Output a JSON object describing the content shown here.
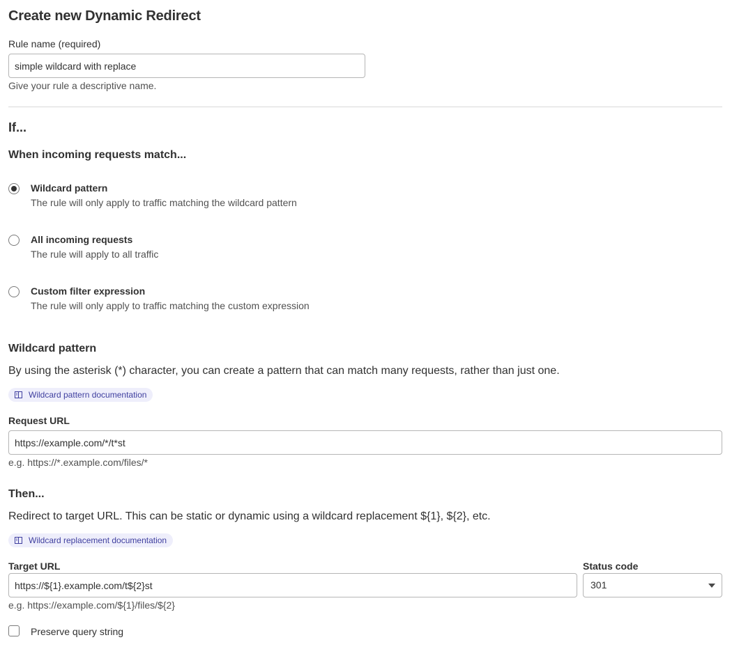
{
  "page": {
    "title": "Create new Dynamic Redirect"
  },
  "rule_name": {
    "label": "Rule name (required)",
    "value": "simple wildcard with replace",
    "help": "Give your rule a descriptive name."
  },
  "if_section": {
    "heading": "If...",
    "subheading": "When incoming requests match...",
    "options": [
      {
        "title": "Wildcard pattern",
        "description": "The rule will only apply to traffic matching the wildcard pattern",
        "checked": true
      },
      {
        "title": "All incoming requests",
        "description": "The rule will apply to all traffic",
        "checked": false
      },
      {
        "title": "Custom filter expression",
        "description": "The rule will only apply to traffic matching the custom expression",
        "checked": false
      }
    ]
  },
  "wildcard": {
    "heading": "Wildcard pattern",
    "description": "By using the asterisk (*) character, you can create a pattern that can match many requests, rather than just one.",
    "doc_link": "Wildcard pattern documentation",
    "request_url_label": "Request URL",
    "request_url_value": "https://example.com/*/t*st",
    "request_url_example": "e.g. https://*.example.com/files/*"
  },
  "then_section": {
    "heading": "Then...",
    "description": "Redirect to target URL. This can be static or dynamic using a wildcard replacement ${1}, ${2}, etc.",
    "doc_link": "Wildcard replacement documentation",
    "target_url_label": "Target URL",
    "target_url_value": "https://${1}.example.com/t${2}st",
    "target_url_example": "e.g. https://example.com/${1}/files/${2}",
    "status_code_label": "Status code",
    "status_code_value": "301",
    "preserve_query_label": "Preserve query string"
  },
  "icons": {
    "doc_link_icon": "book-icon",
    "select_caret": "chevron-down-icon"
  },
  "colors": {
    "link_text": "#3f3f9f",
    "link_bg": "#eeeefb"
  }
}
